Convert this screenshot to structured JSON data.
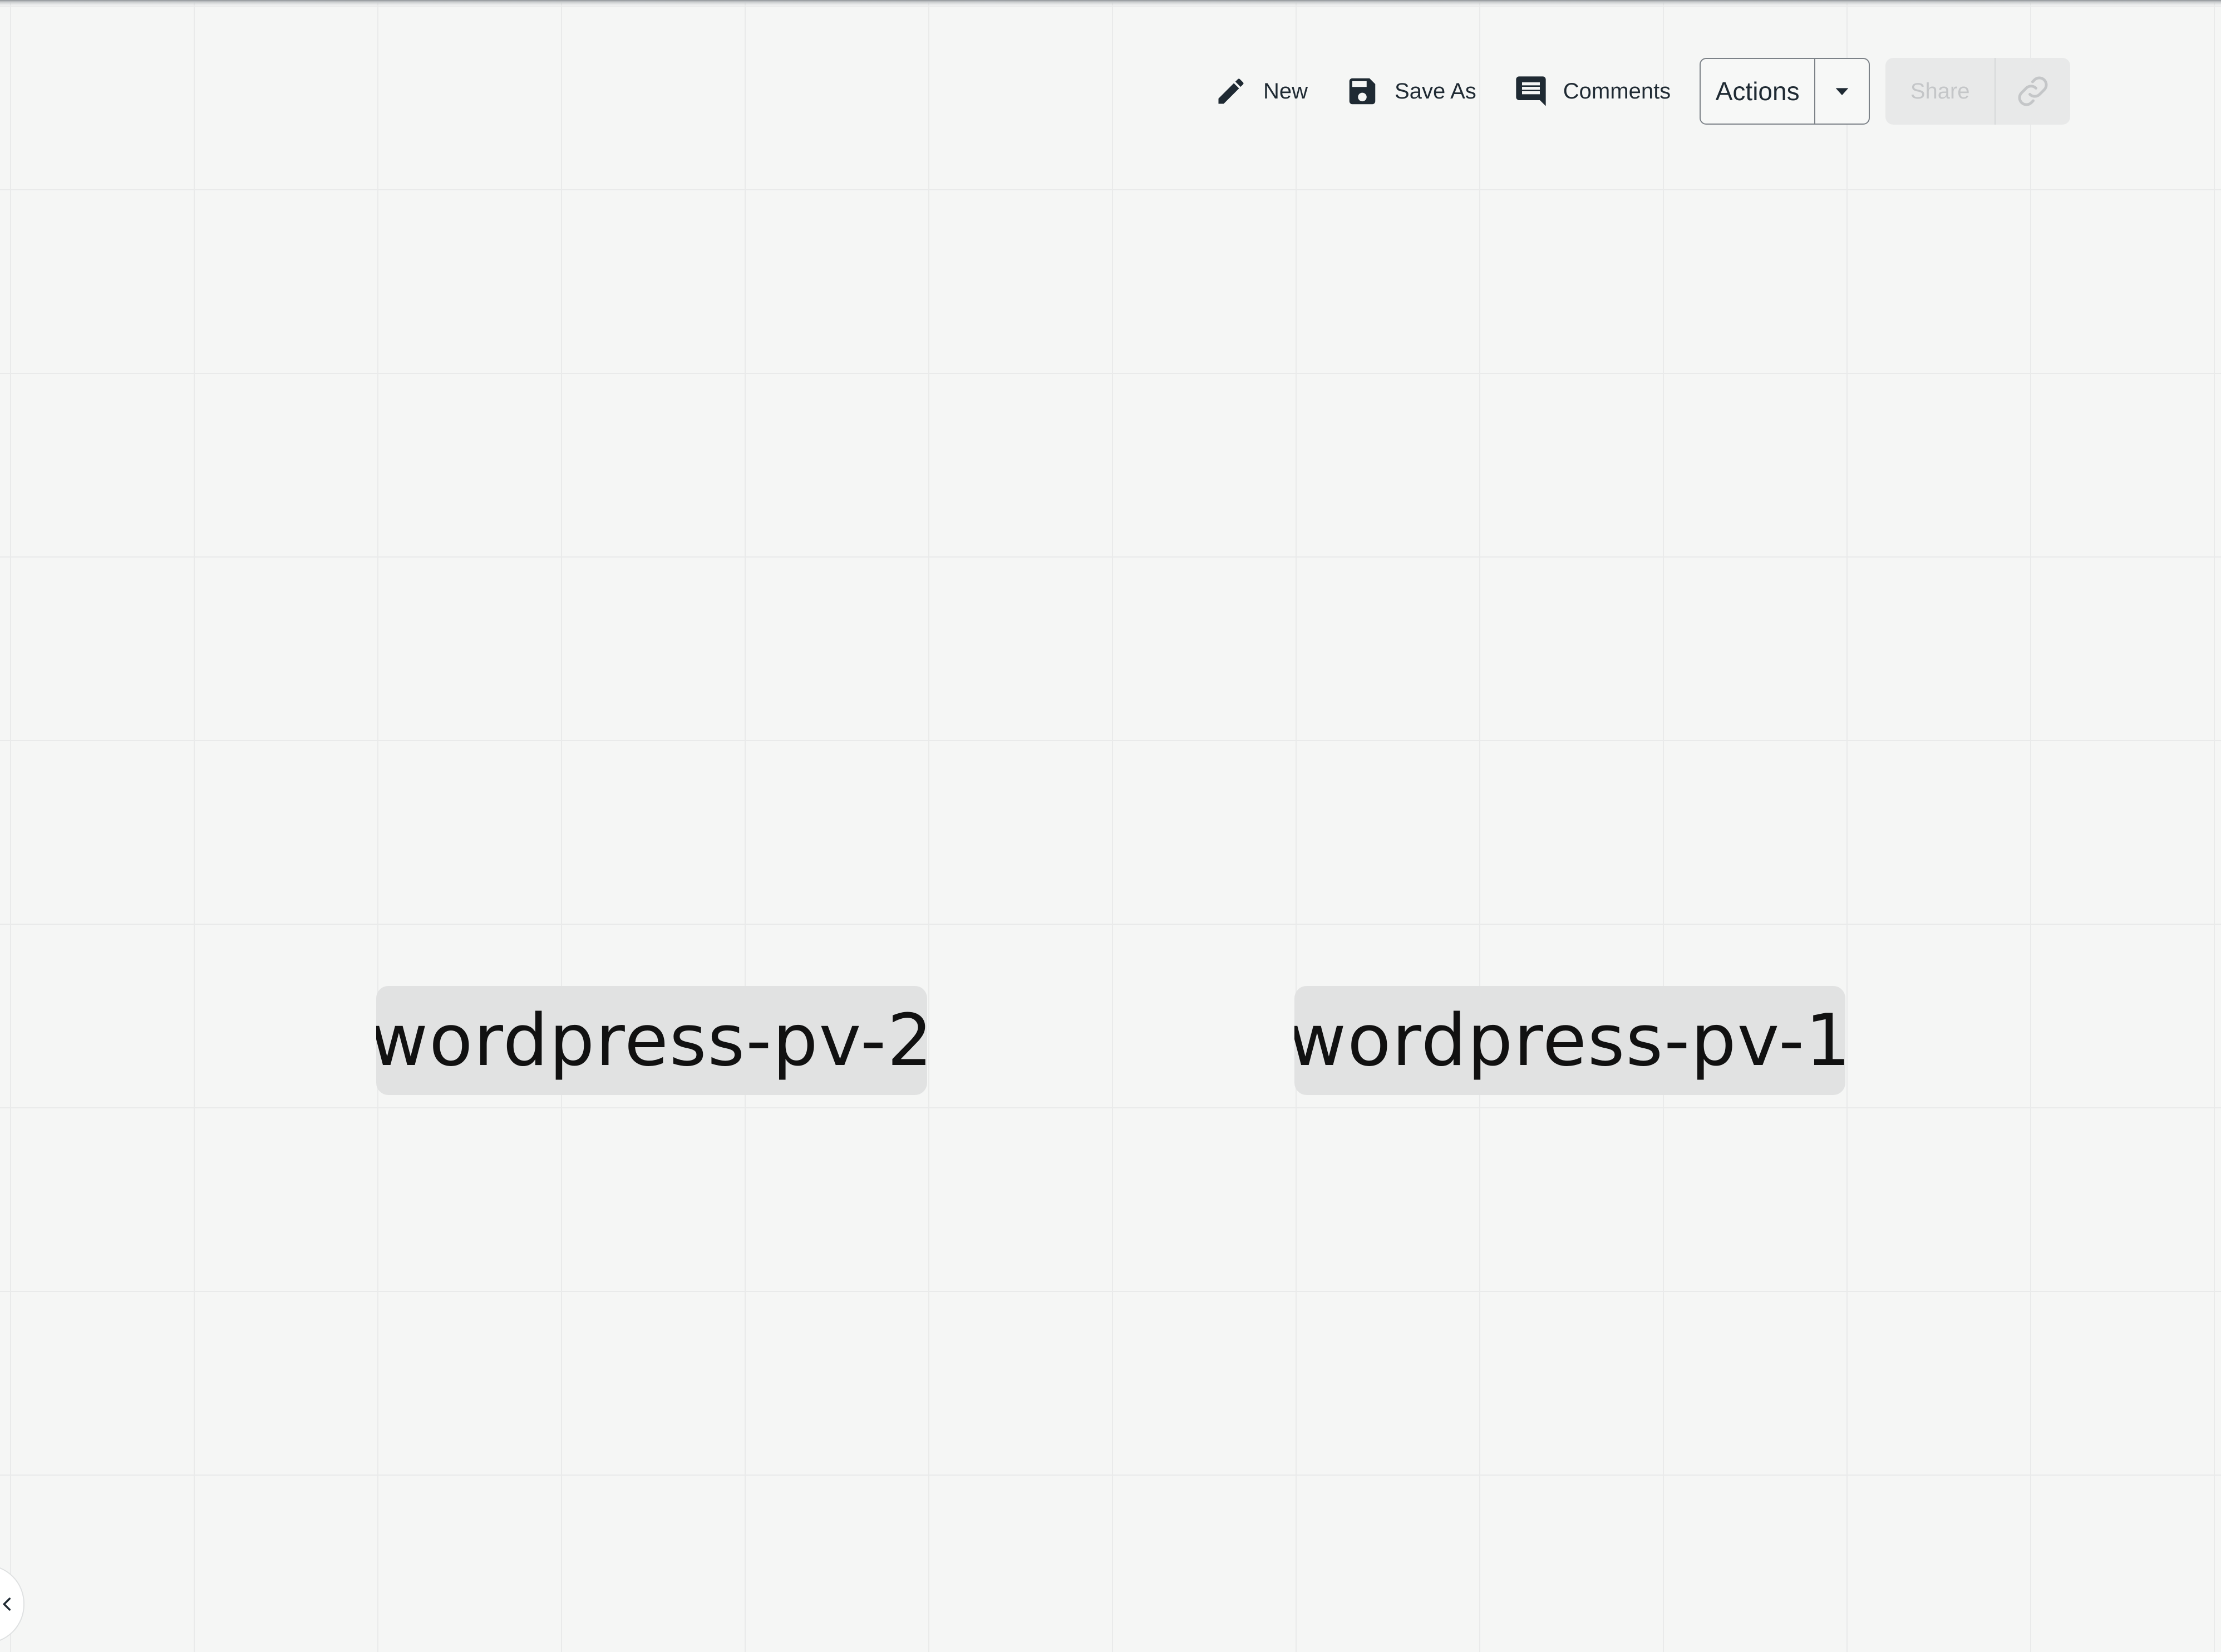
{
  "toolbar": {
    "new_label": "New",
    "save_as_label": "Save As",
    "comments_label": "Comments",
    "actions_label": "Actions",
    "share_label": "Share"
  },
  "nodes": [
    {
      "label": "wordpress-pv-2"
    },
    {
      "label": "wordpress-pv-1"
    }
  ],
  "icons": {
    "new": "pencil-icon",
    "save_as": "floppy-disk-icon",
    "comments": "comment-icon",
    "actions_toggle": "caret-down-icon",
    "share_link": "link-icon",
    "collapse": "chevron-left-icon"
  },
  "colors": {
    "background": "#f5f6f5",
    "grid": "#e9eaea",
    "node_fill": "#e1e2e2",
    "text": "#1f2a33",
    "disabled_text": "#c4c6c8"
  }
}
